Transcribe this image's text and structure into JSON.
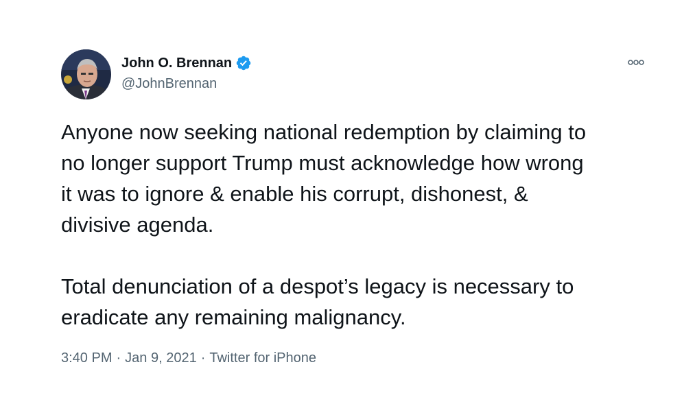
{
  "tweet": {
    "author": {
      "display_name": "John O. Brennan",
      "handle": "@JohnBrennan",
      "verified": true,
      "verified_icon": "verified-badge-icon",
      "avatar_icon": "profile-photo"
    },
    "more_icon": "more-options-icon",
    "text": "Anyone now seeking national redemption by claiming to\nno longer support Trump must acknowledge how wrong\nit was to ignore & enable his corrupt, dishonest, &\ndivisive agenda.\n\nTotal denunciation of a despot’s legacy is necessary to\neradicate any remaining malignancy.",
    "meta": {
      "time": "3:40 PM",
      "separator": "·",
      "date": "Jan 9, 2021",
      "source": "Twitter for iPhone"
    }
  },
  "colors": {
    "text_primary": "#0f1419",
    "text_secondary": "#536471",
    "verified_blue": "#1d9bf0",
    "background": "#ffffff"
  }
}
